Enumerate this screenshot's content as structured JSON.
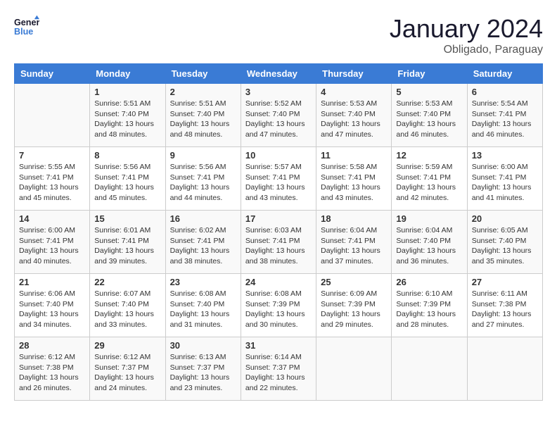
{
  "logo": {
    "line1": "General",
    "line2": "Blue"
  },
  "title": "January 2024",
  "subtitle": "Obligado, Paraguay",
  "headers": [
    "Sunday",
    "Monday",
    "Tuesday",
    "Wednesday",
    "Thursday",
    "Friday",
    "Saturday"
  ],
  "weeks": [
    [
      {
        "day": "",
        "sunrise": "",
        "sunset": "",
        "daylight": ""
      },
      {
        "day": "1",
        "sunrise": "Sunrise: 5:51 AM",
        "sunset": "Sunset: 7:40 PM",
        "daylight": "Daylight: 13 hours and 48 minutes."
      },
      {
        "day": "2",
        "sunrise": "Sunrise: 5:51 AM",
        "sunset": "Sunset: 7:40 PM",
        "daylight": "Daylight: 13 hours and 48 minutes."
      },
      {
        "day": "3",
        "sunrise": "Sunrise: 5:52 AM",
        "sunset": "Sunset: 7:40 PM",
        "daylight": "Daylight: 13 hours and 47 minutes."
      },
      {
        "day": "4",
        "sunrise": "Sunrise: 5:53 AM",
        "sunset": "Sunset: 7:40 PM",
        "daylight": "Daylight: 13 hours and 47 minutes."
      },
      {
        "day": "5",
        "sunrise": "Sunrise: 5:53 AM",
        "sunset": "Sunset: 7:40 PM",
        "daylight": "Daylight: 13 hours and 46 minutes."
      },
      {
        "day": "6",
        "sunrise": "Sunrise: 5:54 AM",
        "sunset": "Sunset: 7:41 PM",
        "daylight": "Daylight: 13 hours and 46 minutes."
      }
    ],
    [
      {
        "day": "7",
        "sunrise": "Sunrise: 5:55 AM",
        "sunset": "Sunset: 7:41 PM",
        "daylight": "Daylight: 13 hours and 45 minutes."
      },
      {
        "day": "8",
        "sunrise": "Sunrise: 5:56 AM",
        "sunset": "Sunset: 7:41 PM",
        "daylight": "Daylight: 13 hours and 45 minutes."
      },
      {
        "day": "9",
        "sunrise": "Sunrise: 5:56 AM",
        "sunset": "Sunset: 7:41 PM",
        "daylight": "Daylight: 13 hours and 44 minutes."
      },
      {
        "day": "10",
        "sunrise": "Sunrise: 5:57 AM",
        "sunset": "Sunset: 7:41 PM",
        "daylight": "Daylight: 13 hours and 43 minutes."
      },
      {
        "day": "11",
        "sunrise": "Sunrise: 5:58 AM",
        "sunset": "Sunset: 7:41 PM",
        "daylight": "Daylight: 13 hours and 43 minutes."
      },
      {
        "day": "12",
        "sunrise": "Sunrise: 5:59 AM",
        "sunset": "Sunset: 7:41 PM",
        "daylight": "Daylight: 13 hours and 42 minutes."
      },
      {
        "day": "13",
        "sunrise": "Sunrise: 6:00 AM",
        "sunset": "Sunset: 7:41 PM",
        "daylight": "Daylight: 13 hours and 41 minutes."
      }
    ],
    [
      {
        "day": "14",
        "sunrise": "Sunrise: 6:00 AM",
        "sunset": "Sunset: 7:41 PM",
        "daylight": "Daylight: 13 hours and 40 minutes."
      },
      {
        "day": "15",
        "sunrise": "Sunrise: 6:01 AM",
        "sunset": "Sunset: 7:41 PM",
        "daylight": "Daylight: 13 hours and 39 minutes."
      },
      {
        "day": "16",
        "sunrise": "Sunrise: 6:02 AM",
        "sunset": "Sunset: 7:41 PM",
        "daylight": "Daylight: 13 hours and 38 minutes."
      },
      {
        "day": "17",
        "sunrise": "Sunrise: 6:03 AM",
        "sunset": "Sunset: 7:41 PM",
        "daylight": "Daylight: 13 hours and 38 minutes."
      },
      {
        "day": "18",
        "sunrise": "Sunrise: 6:04 AM",
        "sunset": "Sunset: 7:41 PM",
        "daylight": "Daylight: 13 hours and 37 minutes."
      },
      {
        "day": "19",
        "sunrise": "Sunrise: 6:04 AM",
        "sunset": "Sunset: 7:40 PM",
        "daylight": "Daylight: 13 hours and 36 minutes."
      },
      {
        "day": "20",
        "sunrise": "Sunrise: 6:05 AM",
        "sunset": "Sunset: 7:40 PM",
        "daylight": "Daylight: 13 hours and 35 minutes."
      }
    ],
    [
      {
        "day": "21",
        "sunrise": "Sunrise: 6:06 AM",
        "sunset": "Sunset: 7:40 PM",
        "daylight": "Daylight: 13 hours and 34 minutes."
      },
      {
        "day": "22",
        "sunrise": "Sunrise: 6:07 AM",
        "sunset": "Sunset: 7:40 PM",
        "daylight": "Daylight: 13 hours and 33 minutes."
      },
      {
        "day": "23",
        "sunrise": "Sunrise: 6:08 AM",
        "sunset": "Sunset: 7:40 PM",
        "daylight": "Daylight: 13 hours and 31 minutes."
      },
      {
        "day": "24",
        "sunrise": "Sunrise: 6:08 AM",
        "sunset": "Sunset: 7:39 PM",
        "daylight": "Daylight: 13 hours and 30 minutes."
      },
      {
        "day": "25",
        "sunrise": "Sunrise: 6:09 AM",
        "sunset": "Sunset: 7:39 PM",
        "daylight": "Daylight: 13 hours and 29 minutes."
      },
      {
        "day": "26",
        "sunrise": "Sunrise: 6:10 AM",
        "sunset": "Sunset: 7:39 PM",
        "daylight": "Daylight: 13 hours and 28 minutes."
      },
      {
        "day": "27",
        "sunrise": "Sunrise: 6:11 AM",
        "sunset": "Sunset: 7:38 PM",
        "daylight": "Daylight: 13 hours and 27 minutes."
      }
    ],
    [
      {
        "day": "28",
        "sunrise": "Sunrise: 6:12 AM",
        "sunset": "Sunset: 7:38 PM",
        "daylight": "Daylight: 13 hours and 26 minutes."
      },
      {
        "day": "29",
        "sunrise": "Sunrise: 6:12 AM",
        "sunset": "Sunset: 7:37 PM",
        "daylight": "Daylight: 13 hours and 24 minutes."
      },
      {
        "day": "30",
        "sunrise": "Sunrise: 6:13 AM",
        "sunset": "Sunset: 7:37 PM",
        "daylight": "Daylight: 13 hours and 23 minutes."
      },
      {
        "day": "31",
        "sunrise": "Sunrise: 6:14 AM",
        "sunset": "Sunset: 7:37 PM",
        "daylight": "Daylight: 13 hours and 22 minutes."
      },
      {
        "day": "",
        "sunrise": "",
        "sunset": "",
        "daylight": ""
      },
      {
        "day": "",
        "sunrise": "",
        "sunset": "",
        "daylight": ""
      },
      {
        "day": "",
        "sunrise": "",
        "sunset": "",
        "daylight": ""
      }
    ]
  ]
}
